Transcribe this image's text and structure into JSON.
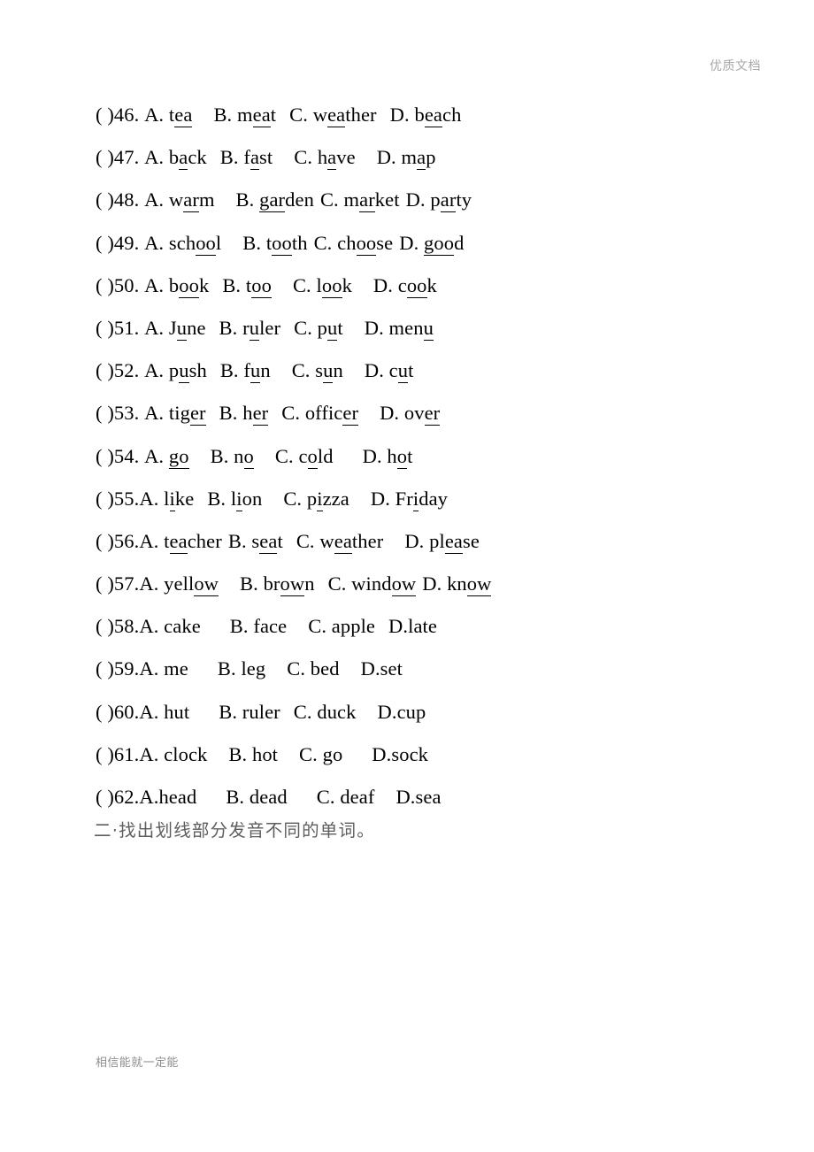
{
  "header": {
    "watermark_text": "优质文档",
    "color": "#a8a8a8"
  },
  "footer": {
    "text": "相信能就一定能",
    "color": "#8e8e8e"
  },
  "section_heading": {
    "text": "二·找出划线部分发音不同的单词。",
    "color": "#5d5d5d"
  },
  "exercise": {
    "bracket": "(  )",
    "questions": [
      {
        "number": "46.",
        "num_gap": " ",
        "options": [
          {
            "letter": "A.",
            "gap": "  ",
            "pre": "t",
            "mark": "ea",
            "post": "",
            "trail": "sp-l"
          },
          {
            "letter": "B.",
            "gap": "  ",
            "pre": "m",
            "mark": "ea",
            "post": "t",
            "trail": "sp-m"
          },
          {
            "letter": "C.",
            "gap": "  ",
            "pre": "w",
            "mark": "ea",
            "post": "ther",
            "trail": "sp-m"
          },
          {
            "letter": "D.",
            "gap": "  ",
            "pre": "b",
            "mark": "ea",
            "post": "ch",
            "trail": ""
          }
        ]
      },
      {
        "number": "47.",
        "num_gap": " ",
        "options": [
          {
            "letter": "A.",
            "gap": " ",
            "pre": "b",
            "mark": "a",
            "post": "ck",
            "trail": "sp-m"
          },
          {
            "letter": "B.",
            "gap": " ",
            "pre": "f",
            "mark": "a",
            "post": "st",
            "trail": "sp-l"
          },
          {
            "letter": "C.",
            "gap": " ",
            "pre": "h",
            "mark": "a",
            "post": "ve",
            "trail": "sp-l"
          },
          {
            "letter": "D.",
            "gap": " ",
            "pre": "m",
            "mark": "a",
            "post": "p",
            "trail": ""
          }
        ]
      },
      {
        "number": "48.",
        "num_gap": " ",
        "options": [
          {
            "letter": "A.",
            "gap": "  ",
            "pre": "w",
            "mark": "ar",
            "post": "m",
            "trail": "sp-l"
          },
          {
            "letter": "B.",
            "gap": " ",
            "pre": "",
            "mark": "gar",
            "post": "den",
            "trail": "sp-s"
          },
          {
            "letter": "C.",
            "gap": " ",
            "pre": "m",
            "mark": "ar",
            "post": "ket",
            "trail": "sp-s"
          },
          {
            "letter": "D.",
            "gap": " ",
            "pre": "p",
            "mark": "ar",
            "post": "ty",
            "trail": ""
          }
        ]
      },
      {
        "number": "49.",
        "num_gap": " ",
        "options": [
          {
            "letter": "A.",
            "gap": "  ",
            "pre": "sch",
            "mark": "oo",
            "post": "l",
            "trail": "sp-l"
          },
          {
            "letter": "B.",
            "gap": " ",
            "pre": "t",
            "mark": "oo",
            "post": "th",
            "trail": "sp-s"
          },
          {
            "letter": "C.",
            "gap": " ",
            "pre": "ch",
            "mark": "oo",
            "post": "se",
            "trail": "sp-s"
          },
          {
            "letter": "D.",
            "gap": " ",
            "pre": "",
            "mark": "goo",
            "post": "d",
            "trail": ""
          }
        ]
      },
      {
        "number": "50.",
        "num_gap": " ",
        "options": [
          {
            "letter": "A.",
            "gap": "  ",
            "pre": "b",
            "mark": "oo",
            "post": "k",
            "trail": "sp-m"
          },
          {
            "letter": "B.",
            "gap": " ",
            "pre": "t",
            "mark": "oo",
            "post": "",
            "trail": "sp-l"
          },
          {
            "letter": "C.",
            "gap": " ",
            "pre": "l",
            "mark": "oo",
            "post": "k",
            "trail": "sp-l"
          },
          {
            "letter": "D.",
            "gap": " ",
            "pre": "c",
            "mark": "oo",
            "post": "k",
            "trail": ""
          }
        ]
      },
      {
        "number": "51.",
        "num_gap": " ",
        "options": [
          {
            "letter": "A.",
            "gap": "  ",
            "pre": "J",
            "mark": "u",
            "post": "ne",
            "trail": "sp-m"
          },
          {
            "letter": "B.",
            "gap": " ",
            "pre": "r",
            "mark": "u",
            "post": "ler",
            "trail": "sp-m"
          },
          {
            "letter": "C.",
            "gap": " ",
            "pre": "p",
            "mark": "u",
            "post": "t",
            "trail": "sp-l"
          },
          {
            "letter": "D.",
            "gap": " ",
            "pre": "men",
            "mark": "u",
            "post": "",
            "trail": ""
          }
        ]
      },
      {
        "number": "52.",
        "num_gap": " ",
        "options": [
          {
            "letter": "A.",
            "gap": "  ",
            "pre": "p",
            "mark": "u",
            "post": "sh",
            "trail": "sp-m"
          },
          {
            "letter": "B.",
            "gap": " ",
            "pre": "f",
            "mark": "u",
            "post": "n",
            "trail": "sp-l"
          },
          {
            "letter": "C.",
            "gap": " ",
            "pre": "s",
            "mark": "u",
            "post": "n",
            "trail": "sp-l"
          },
          {
            "letter": "D.",
            "gap": " ",
            "pre": "c",
            "mark": "u",
            "post": "t",
            "trail": ""
          }
        ]
      },
      {
        "number": "53.",
        "num_gap": " ",
        "options": [
          {
            "letter": "A.",
            "gap": "  ",
            "pre": "tig",
            "mark": "er",
            "post": "",
            "trail": "sp-m"
          },
          {
            "letter": "B.",
            "gap": " ",
            "pre": "h",
            "mark": "er",
            "post": "",
            "trail": "sp-m"
          },
          {
            "letter": "C.",
            "gap": " ",
            "pre": "offic",
            "mark": "er",
            "post": "",
            "trail": "sp-l"
          },
          {
            "letter": "D.",
            "gap": " ",
            "pre": "ov",
            "mark": "er",
            "post": "",
            "trail": ""
          }
        ]
      },
      {
        "number": "54.",
        "num_gap": " ",
        "options": [
          {
            "letter": "A.",
            "gap": "  ",
            "pre": "",
            "mark": "go",
            "post": "",
            "trail": "sp-l"
          },
          {
            "letter": "B.",
            "gap": " ",
            "pre": "n",
            "mark": "o",
            "post": "",
            "trail": "sp-l"
          },
          {
            "letter": "C.",
            "gap": " ",
            "pre": "c",
            "mark": "o",
            "post": "ld",
            "trail": "sp-xl"
          },
          {
            "letter": "D.",
            "gap": " ",
            "pre": "h",
            "mark": "o",
            "post": "t",
            "trail": ""
          }
        ]
      },
      {
        "number": "55.",
        "num_gap": "",
        "options": [
          {
            "letter": "A.",
            "gap": "  ",
            "pre": "l",
            "mark": "i",
            "post": "ke",
            "trail": "sp-m"
          },
          {
            "letter": "B.",
            "gap": " ",
            "pre": "l",
            "mark": "i",
            "post": "on",
            "trail": "sp-l"
          },
          {
            "letter": "C.",
            "gap": " ",
            "pre": "p",
            "mark": "i",
            "post": "zza",
            "trail": "sp-l"
          },
          {
            "letter": "D.",
            "gap": " ",
            "pre": "Fr",
            "mark": "i",
            "post": "day",
            "trail": ""
          }
        ]
      },
      {
        "number": "56.",
        "num_gap": "",
        "options": [
          {
            "letter": "A.",
            "gap": "  ",
            "pre": "t",
            "mark": "ea",
            "post": "cher",
            "trail": "sp-s"
          },
          {
            "letter": "B.",
            "gap": " ",
            "pre": "s",
            "mark": "ea",
            "post": "t",
            "trail": "sp-m"
          },
          {
            "letter": "C.",
            "gap": " ",
            "pre": "w",
            "mark": "ea",
            "post": "ther",
            "trail": "sp-l"
          },
          {
            "letter": "D.",
            "gap": " ",
            "pre": "pl",
            "mark": "ea",
            "post": "se",
            "trail": ""
          }
        ]
      },
      {
        "number": "57.",
        "num_gap": "",
        "options": [
          {
            "letter": "A.",
            "gap": "  ",
            "pre": "yell",
            "mark": "ow",
            "post": "",
            "trail": "sp-l"
          },
          {
            "letter": "B.",
            "gap": " ",
            "pre": "br",
            "mark": "ow",
            "post": "n",
            "trail": "sp-m"
          },
          {
            "letter": "C.",
            "gap": " ",
            "pre": "wind",
            "mark": "ow ",
            "post": "",
            "trail": "sp-s"
          },
          {
            "letter": "D.",
            "gap": " ",
            "pre": "kn",
            "mark": "ow",
            "post": "",
            "trail": ""
          }
        ]
      },
      {
        "number": "58.",
        "num_gap": "",
        "options": [
          {
            "letter": "A.",
            "gap": " ",
            "pre": "cake",
            "mark": "",
            "post": "",
            "trail": "sp-xl"
          },
          {
            "letter": "B.",
            "gap": " ",
            "pre": "face",
            "mark": "",
            "post": "",
            "trail": "sp-l"
          },
          {
            "letter": "C.",
            "gap": " ",
            "pre": "apple",
            "mark": "",
            "post": "",
            "trail": "sp-m"
          },
          {
            "letter": "D.",
            "gap": "",
            "pre": "late",
            "mark": "",
            "post": "",
            "trail": ""
          }
        ]
      },
      {
        "number": "59.",
        "num_gap": "",
        "options": [
          {
            "letter": "A.",
            "gap": " ",
            "pre": "me",
            "mark": "",
            "post": "",
            "trail": "sp-xl"
          },
          {
            "letter": "B.",
            "gap": " ",
            "pre": "leg",
            "mark": "",
            "post": "",
            "trail": "sp-l"
          },
          {
            "letter": "C.",
            "gap": " ",
            "pre": "bed",
            "mark": "",
            "post": "",
            "trail": "sp-l"
          },
          {
            "letter": "D.",
            "gap": "",
            "pre": "set",
            "mark": "",
            "post": "",
            "trail": ""
          }
        ]
      },
      {
        "number": "60.",
        "num_gap": "",
        "options": [
          {
            "letter": "A.",
            "gap": " ",
            "pre": "hut",
            "mark": "",
            "post": "",
            "trail": "sp-xl"
          },
          {
            "letter": "B.",
            "gap": " ",
            "pre": "ruler",
            "mark": "",
            "post": "",
            "trail": "sp-m"
          },
          {
            "letter": "C.",
            "gap": " ",
            "pre": "duck",
            "mark": "",
            "post": "",
            "trail": "sp-l"
          },
          {
            "letter": "D.",
            "gap": "",
            "pre": "cup",
            "mark": "",
            "post": "",
            "trail": ""
          }
        ]
      },
      {
        "number": "61.",
        "num_gap": "",
        "options": [
          {
            "letter": "A.",
            "gap": " ",
            "pre": "clock",
            "mark": "",
            "post": "",
            "trail": "sp-l"
          },
          {
            "letter": "B.",
            "gap": " ",
            "pre": "hot",
            "mark": "",
            "post": "",
            "trail": "sp-l"
          },
          {
            "letter": "C.",
            "gap": " ",
            "pre": "go",
            "mark": "",
            "post": "",
            "trail": "sp-xl"
          },
          {
            "letter": "D.",
            "gap": "",
            "pre": "sock",
            "mark": "",
            "post": "",
            "trail": ""
          }
        ]
      },
      {
        "number": "62.",
        "num_gap": "",
        "options": [
          {
            "letter": "A.",
            "gap": "",
            "pre": "head",
            "mark": "",
            "post": "",
            "trail": "sp-xl"
          },
          {
            "letter": "B.",
            "gap": " ",
            "pre": "dead",
            "mark": "",
            "post": "",
            "trail": "sp-xl"
          },
          {
            "letter": "C.",
            "gap": " ",
            "pre": "deaf",
            "mark": "",
            "post": "",
            "trail": "sp-l"
          },
          {
            "letter": "D.",
            "gap": "",
            "pre": "sea",
            "mark": "",
            "post": "",
            "trail": ""
          }
        ]
      }
    ]
  }
}
